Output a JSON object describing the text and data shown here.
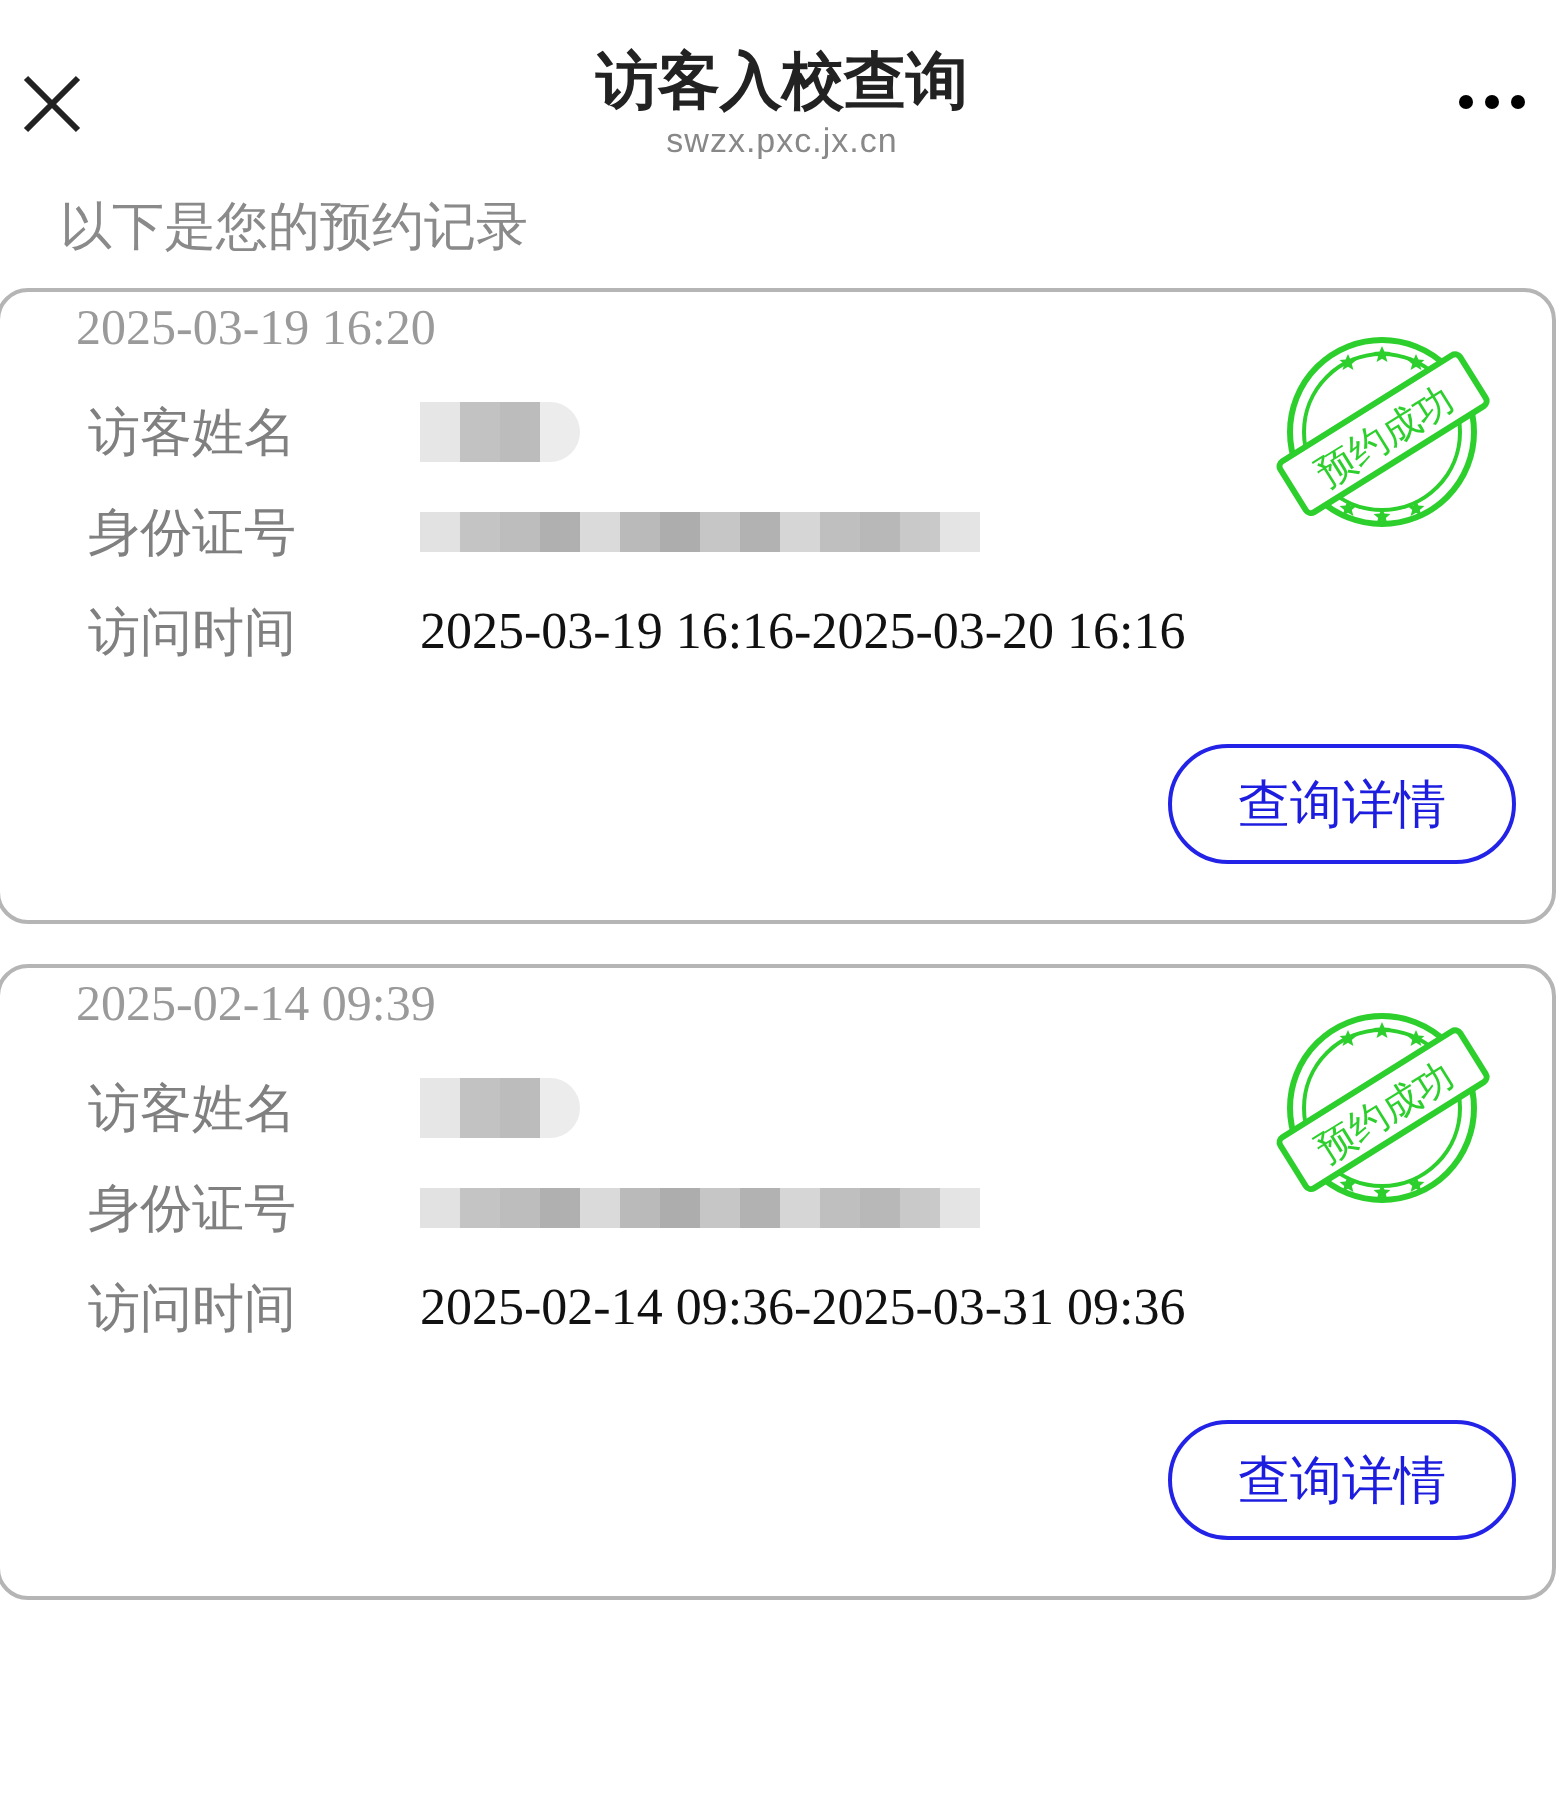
{
  "header": {
    "title": "访客入校查询",
    "domain": "swzx.pxc.jx.cn"
  },
  "intro": "以下是您的预约记录",
  "records": [
    {
      "created": "2025-03-19 16:20",
      "stamp": "预约成功",
      "fields": [
        {
          "label": "访客姓名",
          "kind": "shortmask"
        },
        {
          "label": "身份证号",
          "kind": "longmask"
        },
        {
          "label": "访问时间",
          "kind": "text",
          "value": "2025-03-19 16:16-2025-03-20 16:16"
        }
      ],
      "button": "查询详情"
    },
    {
      "created": "2025-02-14 09:39",
      "stamp": "预约成功",
      "fields": [
        {
          "label": "访客姓名",
          "kind": "shortmask"
        },
        {
          "label": "身份证号",
          "kind": "longmask"
        },
        {
          "label": "访问时间",
          "kind": "text",
          "value": "2025-02-14 09:36-2025-03-31 09:36"
        }
      ],
      "button": "查询详情"
    }
  ]
}
